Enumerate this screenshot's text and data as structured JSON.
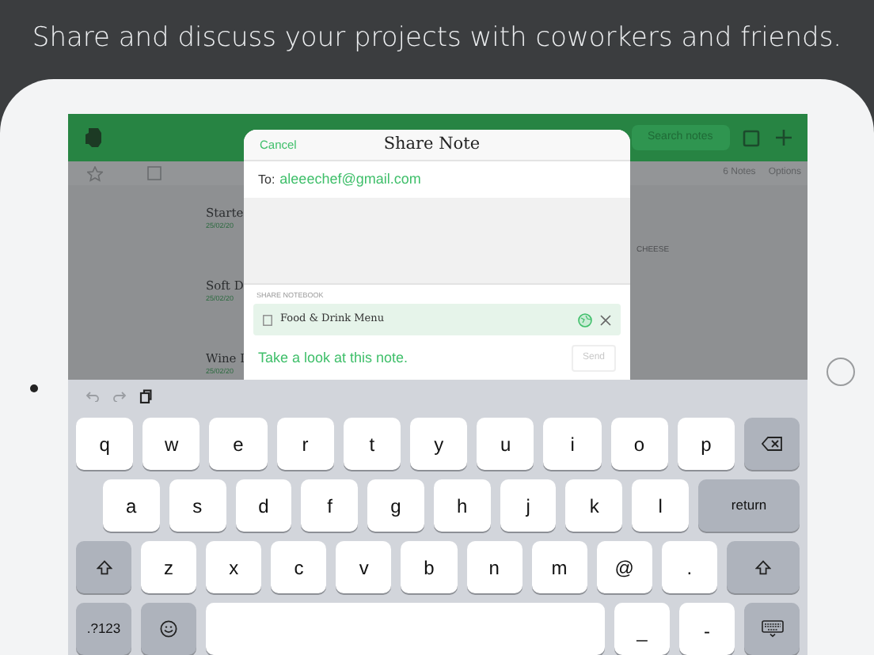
{
  "headline": "Share and discuss your projects with coworkers and friends.",
  "app": {
    "search_placeholder": "Search notes",
    "note_count": "6 Notes",
    "options": "Options",
    "notes": [
      {
        "title": "Starte",
        "date": "25/02/20"
      },
      {
        "title": "Soft D",
        "date": "25/02/20"
      },
      {
        "title": "Wine I",
        "date": "25/02/20"
      }
    ],
    "preview_text": "CHEESE"
  },
  "dialog": {
    "cancel": "Cancel",
    "title": "Share Note",
    "to_label": "To:",
    "recipient": "aleeechef@gmail.com",
    "section_label": "SHARE NOTEBOOK",
    "notebook": "Food & Drink Menu",
    "message": "Take a look at this note.",
    "send": "Send",
    "send_disabled": true
  },
  "keyboard": {
    "rows": [
      [
        {
          "kind": "letter",
          "label": "q"
        },
        {
          "kind": "letter",
          "label": "w"
        },
        {
          "kind": "letter",
          "label": "e"
        },
        {
          "kind": "letter",
          "label": "r"
        },
        {
          "kind": "letter",
          "label": "t"
        },
        {
          "kind": "letter",
          "label": "y"
        },
        {
          "kind": "letter",
          "label": "u"
        },
        {
          "kind": "letter",
          "label": "i"
        },
        {
          "kind": "letter",
          "label": "o"
        },
        {
          "kind": "letter",
          "label": "p"
        },
        {
          "kind": "backspace"
        }
      ],
      [
        {
          "kind": "letter",
          "label": "a"
        },
        {
          "kind": "letter",
          "label": "s"
        },
        {
          "kind": "letter",
          "label": "d"
        },
        {
          "kind": "letter",
          "label": "f"
        },
        {
          "kind": "letter",
          "label": "g"
        },
        {
          "kind": "letter",
          "label": "h"
        },
        {
          "kind": "letter",
          "label": "j"
        },
        {
          "kind": "letter",
          "label": "k"
        },
        {
          "kind": "letter",
          "label": "l"
        },
        {
          "kind": "return",
          "label": "return"
        }
      ],
      [
        {
          "kind": "shift"
        },
        {
          "kind": "letter",
          "label": "z"
        },
        {
          "kind": "letter",
          "label": "x"
        },
        {
          "kind": "letter",
          "label": "c"
        },
        {
          "kind": "letter",
          "label": "v"
        },
        {
          "kind": "letter",
          "label": "b"
        },
        {
          "kind": "letter",
          "label": "n"
        },
        {
          "kind": "letter",
          "label": "m"
        },
        {
          "kind": "letter",
          "label": "@"
        },
        {
          "kind": "letter",
          "label": "."
        },
        {
          "kind": "shift_wide"
        }
      ],
      [
        {
          "kind": "numbers",
          "label": ".?123"
        },
        {
          "kind": "emoji"
        },
        {
          "kind": "space"
        },
        {
          "kind": "low",
          "label": "_"
        },
        {
          "kind": "low",
          "label": "-"
        },
        {
          "kind": "hide"
        }
      ]
    ]
  }
}
